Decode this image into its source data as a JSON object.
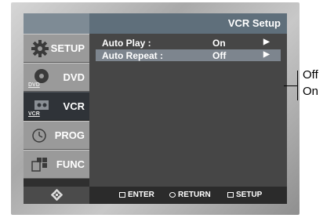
{
  "screen": {
    "title": "VCR Setup"
  },
  "sidebar": {
    "items": [
      {
        "label": "SETUP",
        "icon": "gear-icon"
      },
      {
        "label": "DVD",
        "icon": "disc-icon",
        "tag": "DVD"
      },
      {
        "label": "VCR",
        "icon": "vcr-tape-icon",
        "tag": "VCR"
      },
      {
        "label": "PROG",
        "icon": "clock-icon"
      },
      {
        "label": "FUNC",
        "icon": "function-grid-icon"
      }
    ]
  },
  "menu": {
    "rows": [
      {
        "label": "Auto Play :",
        "value": "On",
        "arrow": "▶"
      },
      {
        "label": "Auto Repeat :",
        "value": "Off",
        "arrow": "▶"
      }
    ]
  },
  "footer": {
    "enter": "ENTER",
    "return": "RETURN",
    "setup": "SETUP"
  },
  "callout": {
    "options": [
      "Off",
      "On"
    ]
  },
  "colors": {
    "highlight": "#7d858e",
    "active_tab": "#2f3338",
    "header": "#5f6f7b"
  }
}
